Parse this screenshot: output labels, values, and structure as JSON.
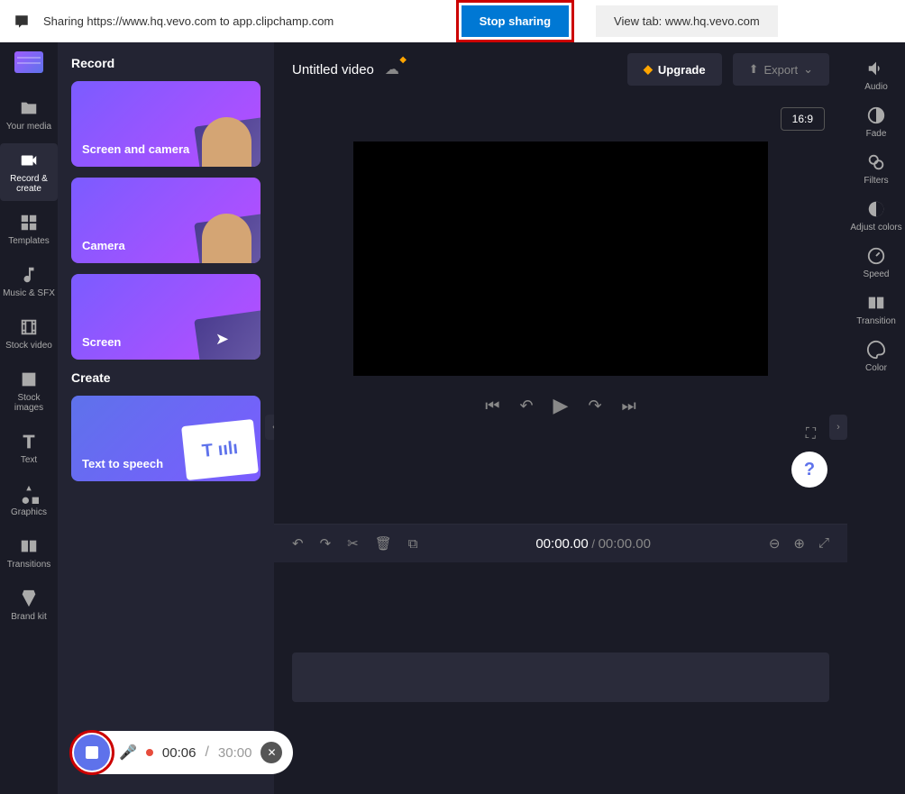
{
  "top_bar": {
    "share_text": "Sharing https://www.hq.vevo.com to app.clipchamp.com",
    "stop": "Stop sharing",
    "view_tab": "View tab: www.hq.vevo.com"
  },
  "nav": {
    "your_media": "Your media",
    "record_create": "Record & create",
    "templates": "Templates",
    "music_sfx": "Music & SFX",
    "stock_video": "Stock video",
    "stock_images": "Stock images",
    "text": "Text",
    "graphics": "Graphics",
    "transitions": "Transitions",
    "brand_kit": "Brand kit"
  },
  "panel": {
    "record_title": "Record",
    "create_title": "Create",
    "screen_camera": "Screen and camera",
    "camera": "Camera",
    "screen": "Screen",
    "tts": "Text to speech"
  },
  "header": {
    "title": "Untitled video",
    "upgrade": "Upgrade",
    "export": "Export",
    "ratio": "16:9"
  },
  "timeline": {
    "current": "00:00.00",
    "total": "00:00.00"
  },
  "right": {
    "audio": "Audio",
    "fade": "Fade",
    "filters": "Filters",
    "adjust": "Adjust colors",
    "speed": "Speed",
    "transition": "Transition",
    "color": "Color"
  },
  "recording": {
    "elapsed": "00:06",
    "max": "30:00"
  }
}
